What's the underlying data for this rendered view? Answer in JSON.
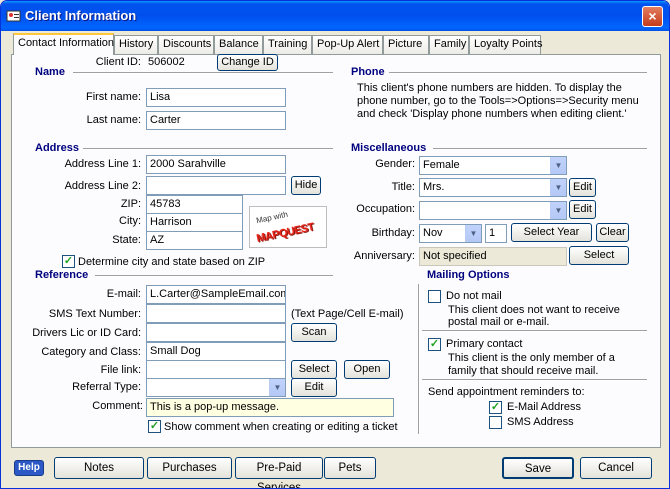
{
  "window": {
    "title": "Client Information",
    "close": "×"
  },
  "tabs": [
    "Contact Information",
    "History",
    "Discounts",
    "Balance",
    "Training",
    "Pop-Up Alert",
    "Picture",
    "Family",
    "Loyalty Points"
  ],
  "name": {
    "section": "Name",
    "client_id_label": "Client ID:",
    "client_id": "506002",
    "change_id_button": "Change ID",
    "first_name_label": "First name:",
    "first_name": "Lisa",
    "last_name_label": "Last name:",
    "last_name": "Carter"
  },
  "address": {
    "section": "Address",
    "line1_label": "Address Line 1:",
    "line1": "2000 Sarahville",
    "line2_label": "Address Line 2:",
    "line2": "",
    "hide_button": "Hide",
    "zip_label": "ZIP:",
    "zip": "45783",
    "city_label": "City:",
    "city": "Harrison",
    "state_label": "State:",
    "state": "AZ",
    "map_small": "Map with",
    "map_big": "MAPQUEST",
    "determine_label": "Determine city and state based on ZIP",
    "determine_checked": true
  },
  "reference": {
    "section": "Reference",
    "email_label": "E-mail:",
    "email": "L.Carter@SampleEmail.com",
    "sms_label": "SMS Text Number:",
    "sms": "",
    "sms_hint": "(Text Page/Cell E-mail)",
    "license_label": "Drivers Lic or ID Card:",
    "license": "",
    "scan_button": "Scan",
    "category_label": "Category and Class:",
    "category": "Small Dog",
    "file_label": "File link:",
    "file": "",
    "select_button": "Select",
    "open_button": "Open",
    "referral_label": "Referral Type:",
    "referral": "",
    "edit_button": "Edit",
    "comment_label": "Comment:",
    "comment": "This is a pop-up message.",
    "show_comment_label": "Show comment when creating or editing a ticket",
    "show_comment_checked": true
  },
  "phone": {
    "section": "Phone",
    "line1": "This client's phone numbers are hidden.  To display the",
    "line2": "phone number, go to the Tools=>Options=>Security menu",
    "line3": "and check 'Display phone numbers when editing client.'"
  },
  "misc": {
    "section": "Miscellaneous",
    "gender_label": "Gender:",
    "gender": "Female",
    "title_label": "Title:",
    "title": "Mrs.",
    "title_edit": "Edit",
    "occupation_label": "Occupation:",
    "occupation": "",
    "occupation_edit": "Edit",
    "birthday_label": "Birthday:",
    "birthday_month": "Nov",
    "birthday_day": "1",
    "select_year_button": "Select Year",
    "clear_button": "Clear",
    "anniversary_label": "Anniversary:",
    "anniversary": "Not specified",
    "anniversary_select": "Select"
  },
  "mailing": {
    "section": "Mailing Options",
    "do_not_mail_label": "Do not mail",
    "do_not_mail_checked": false,
    "do_not_mail_desc1": "This client does not want to receive",
    "do_not_mail_desc2": "postal mail or e-mail.",
    "primary_label": "Primary contact",
    "primary_checked": true,
    "primary_desc1": "This client is the only member of a",
    "primary_desc2": "family that should receive mail.",
    "reminders_label": "Send appointment reminders to:",
    "email_addr_label": "E-Mail Address",
    "email_addr_checked": true,
    "sms_addr_label": "SMS Address",
    "sms_addr_checked": false
  },
  "footer": {
    "help": "Help",
    "notes": "Notes",
    "purchases": "Purchases",
    "prepaid": "Pre-Paid Services",
    "pets": "Pets",
    "save": "Save",
    "cancel": "Cancel"
  }
}
